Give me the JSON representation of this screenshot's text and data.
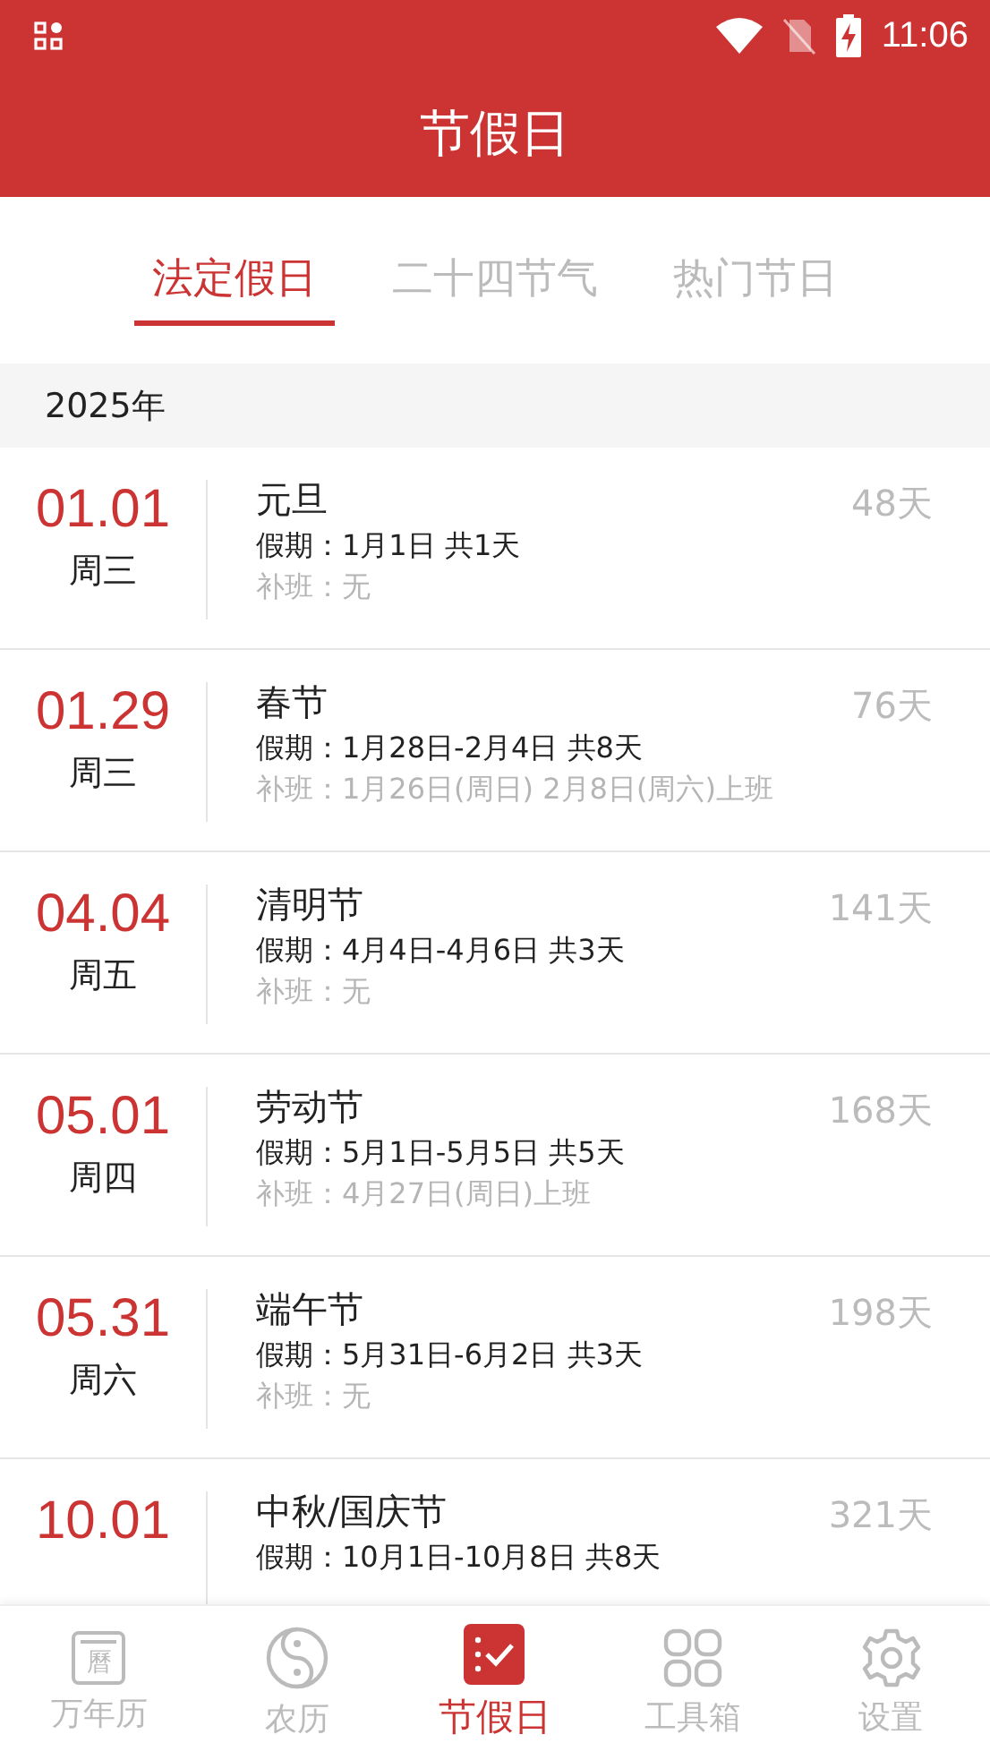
{
  "status_bar": {
    "time": "11:06"
  },
  "title": "节假日",
  "tabs": [
    {
      "label": "法定假日",
      "selected": true
    },
    {
      "label": "二十四节气",
      "selected": false
    },
    {
      "label": "热门节日",
      "selected": false
    }
  ],
  "year_header": "2025年",
  "holidays": [
    {
      "date": "01.01",
      "weekday": "周三",
      "name": "元旦",
      "holiday": "假期：1月1日 共1天",
      "makeup": "补班：无",
      "days": "48天"
    },
    {
      "date": "01.29",
      "weekday": "周三",
      "name": "春节",
      "holiday": "假期：1月28日-2月4日 共8天",
      "makeup": "补班：1月26日(周日) 2月8日(周六)上班",
      "days": "76天"
    },
    {
      "date": "04.04",
      "weekday": "周五",
      "name": "清明节",
      "holiday": "假期：4月4日-4月6日 共3天",
      "makeup": "补班：无",
      "days": "141天"
    },
    {
      "date": "05.01",
      "weekday": "周四",
      "name": "劳动节",
      "holiday": "假期：5月1日-5月5日 共5天",
      "makeup": "补班：4月27日(周日)上班",
      "days": "168天"
    },
    {
      "date": "05.31",
      "weekday": "周六",
      "name": "端午节",
      "holiday": "假期：5月31日-6月2日 共3天",
      "makeup": "补班：无",
      "days": "198天"
    },
    {
      "date": "10.01",
      "name": "中秋/国庆节",
      "holiday": "假期：10月1日-10月8日 共8天",
      "days": "321天"
    }
  ],
  "nav": [
    {
      "kind": "calendar",
      "label": "万年历",
      "glyph": "曆",
      "selected": false
    },
    {
      "kind": "yinyang",
      "label": "农历",
      "selected": false
    },
    {
      "kind": "holiday",
      "label": "节假日",
      "selected": true
    },
    {
      "kind": "tools",
      "label": "工具箱",
      "selected": false
    },
    {
      "kind": "settings",
      "label": "设置",
      "selected": false
    }
  ]
}
